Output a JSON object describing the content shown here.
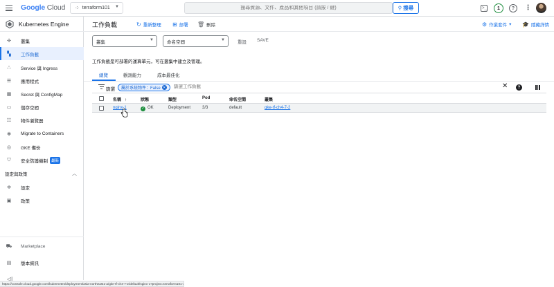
{
  "topbar": {
    "logo_google": "Google",
    "logo_cloud": "Cloud",
    "project": "terraform101",
    "search_placeholder": "搜尋資源、文件、產品和其他項目 (請按 / 鍵)",
    "search_button": "搜尋",
    "notification_count": "1"
  },
  "sidebar": {
    "title": "Kubernetes Engine",
    "items": [
      {
        "label": "叢集",
        "icon": "cluster-icon"
      },
      {
        "label": "工作負載",
        "icon": "workloads-icon"
      },
      {
        "label": "Service 與 Ingress",
        "icon": "network-icon"
      },
      {
        "label": "應用程式",
        "icon": "apps-icon"
      },
      {
        "label": "Secret 與 ConfigMap",
        "icon": "grid-icon"
      },
      {
        "label": "儲存空間",
        "icon": "storage-icon"
      },
      {
        "label": "物件瀏覽器",
        "icon": "list-icon"
      },
      {
        "label": "Migrate to Containers",
        "icon": "migrate-icon"
      },
      {
        "label": "GKE 備份",
        "icon": "backup-icon"
      },
      {
        "label": "安全防護機制",
        "icon": "shield-icon",
        "badge": "最新"
      }
    ],
    "section_title": "設定與政策",
    "section_items": [
      {
        "label": "設定",
        "icon": "gear-icon"
      },
      {
        "label": "政策",
        "icon": "policy-icon"
      }
    ],
    "marketplace": "Marketplace",
    "release_notes": "版本資訊"
  },
  "header": {
    "title": "工作負載",
    "refresh": "重新整理",
    "deploy": "部署",
    "delete": "刪除",
    "operations": "作業套件",
    "learn": "隱藏詳情"
  },
  "filters": {
    "cluster_placeholder": "叢集",
    "namespace_placeholder": "命名空間",
    "reset": "重設",
    "save": "SAVE"
  },
  "description": "工作負載是可部署的運算單元，可在叢集中建立及管理。",
  "tabs": [
    "總覽",
    "觀測能力",
    "成本最佳化"
  ],
  "filter_bar": {
    "label": "篩選",
    "chip": "屬於系統物件：False",
    "input_placeholder": "篩選工作負載"
  },
  "table": {
    "columns": [
      "名稱",
      "狀態",
      "類型",
      "Pod",
      "命名空間",
      "叢集"
    ],
    "rows": [
      {
        "name": "nginx-1",
        "status": "OK",
        "type": "Deployment",
        "pods": "3/3",
        "namespace": "default",
        "cluster": "gke-tf-ch4-7-2"
      }
    ]
  },
  "status_url": "https://console.cloud.google.com/kubernetes/deployment/asia-northeast1-a/gke-tf-ch4-7-2/default/nginx-1?project=terraform101-384527&pageState=..."
}
